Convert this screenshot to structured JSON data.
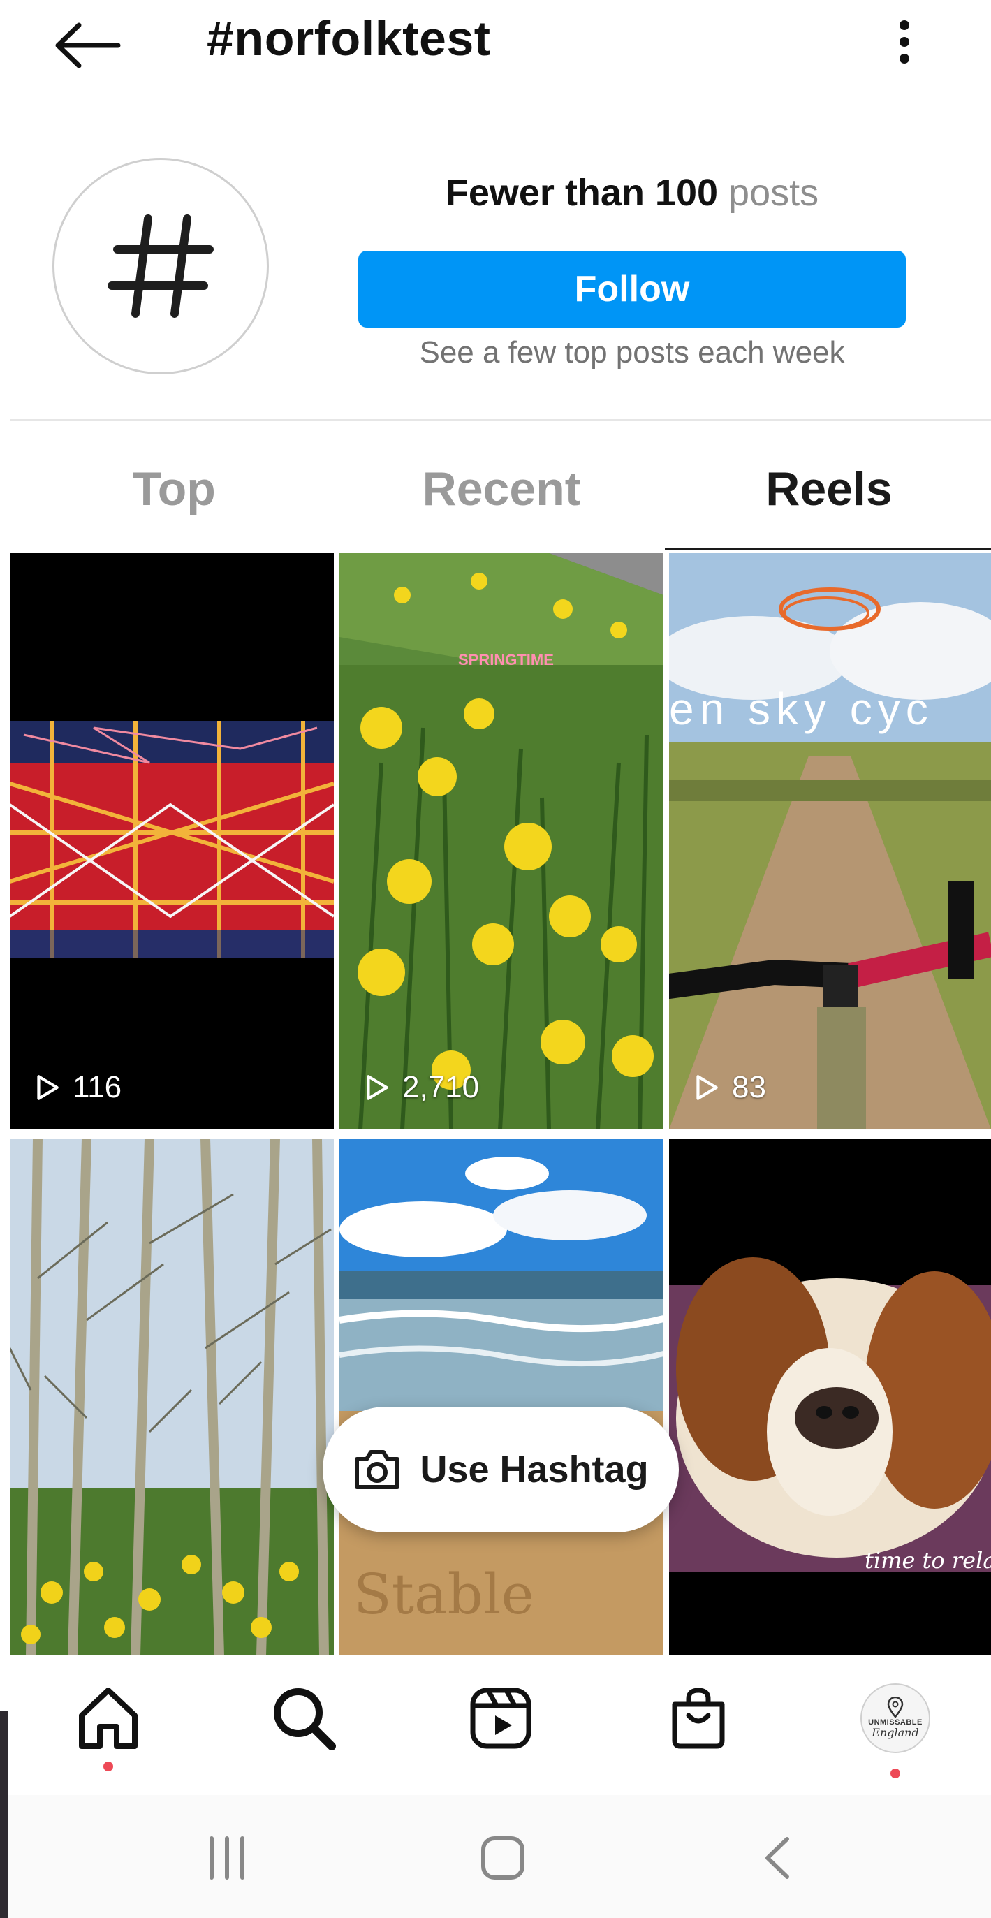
{
  "header": {
    "title": "#norfolktest"
  },
  "profile": {
    "avatar_glyph": "#",
    "post_count_strong": "Fewer than 100",
    "post_count_word": "posts",
    "follow_label": "Follow",
    "follow_subtitle": "See a few top posts each week"
  },
  "tabs": [
    {
      "label": "Top",
      "active": false
    },
    {
      "label": "Recent",
      "active": false
    },
    {
      "label": "Reels",
      "active": true
    }
  ],
  "reels": [
    {
      "subject": "tartan fabric with embroidery",
      "plays": "116"
    },
    {
      "subject": "daffodils by a path",
      "overlay_text": "SPRINGTIME",
      "plays": "2,710"
    },
    {
      "subject": "gravel road from a bicycle",
      "overlay_text": "en sky cyc",
      "plays": "83"
    },
    {
      "subject": "birch trees with daffodils"
    },
    {
      "subject": "beach waves and sand writing"
    },
    {
      "subject": "spaniel dog relaxing",
      "overlay_text": "time to relax"
    }
  ],
  "use_hashtag_label": "Use Hashtag",
  "bottom_nav": {
    "items": [
      "home-icon",
      "search-icon",
      "reels-icon",
      "shop-icon",
      "profile-avatar"
    ],
    "profile_avatar_text_1": "UNMISSABLE",
    "profile_avatar_text_2": "England"
  },
  "colors": {
    "follow_blue": "#0095f6",
    "notification_red": "#ed4956",
    "inactive_tab": "#9a9a9a"
  }
}
